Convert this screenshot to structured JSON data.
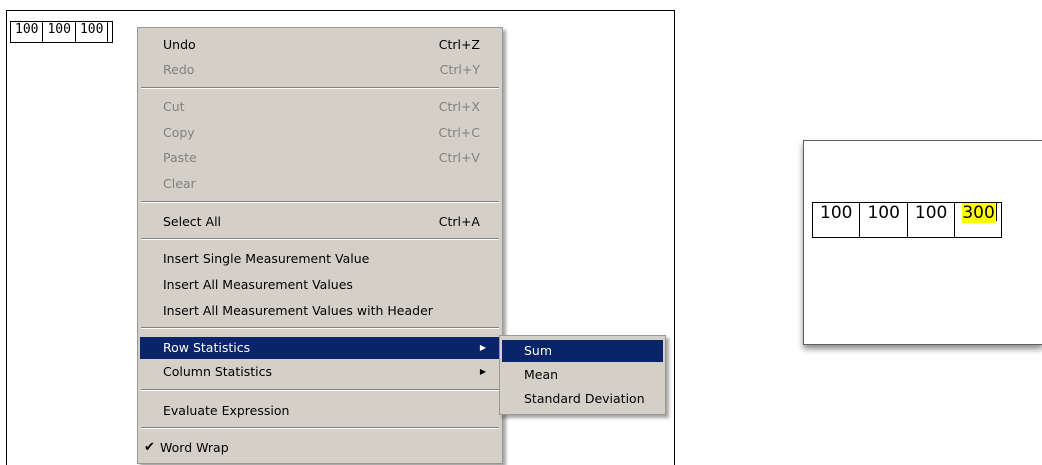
{
  "editor": {
    "cells": [
      "100",
      "100",
      "100"
    ]
  },
  "context_menu": {
    "undo": {
      "label": "Undo",
      "shortcut": "Ctrl+Z"
    },
    "redo": {
      "label": "Redo",
      "shortcut": "Ctrl+Y"
    },
    "cut": {
      "label": "Cut",
      "shortcut": "Ctrl+X"
    },
    "copy": {
      "label": "Copy",
      "shortcut": "Ctrl+C"
    },
    "paste": {
      "label": "Paste",
      "shortcut": "Ctrl+V"
    },
    "clear": {
      "label": "Clear"
    },
    "select_all": {
      "label": "Select All",
      "shortcut": "Ctrl+A"
    },
    "insert_single": {
      "label": "Insert Single Measurement Value"
    },
    "insert_all": {
      "label": "Insert All Measurement Values"
    },
    "insert_all_header": {
      "label": "Insert All Measurement Values with Header"
    },
    "row_statistics": {
      "label": "Row Statistics"
    },
    "column_statistics": {
      "label": "Column Statistics"
    },
    "evaluate_expression": {
      "label": "Evaluate Expression"
    },
    "word_wrap": {
      "label": "Word Wrap",
      "checked": true
    }
  },
  "submenu": {
    "sum": "Sum",
    "mean": "Mean",
    "std_dev": "Standard Deviation"
  },
  "result": {
    "cells": [
      "100",
      "100",
      "100"
    ],
    "sum_value": "300",
    "highlight_color": "#ffff00"
  },
  "colors": {
    "menu_bg": "#d4d0c8",
    "highlight_bg": "#0a246a",
    "disabled_text": "#808080"
  }
}
